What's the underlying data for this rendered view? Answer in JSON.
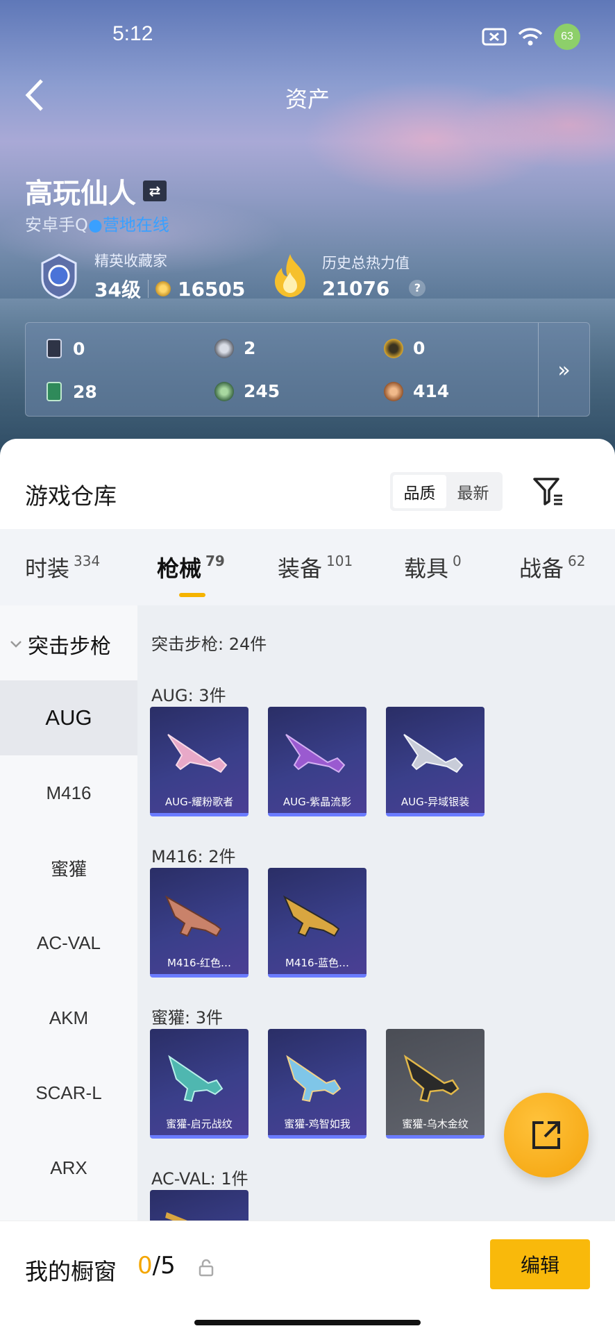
{
  "status_bar": {
    "time": "5:12",
    "battery": "63"
  },
  "header": {
    "title": "资产"
  },
  "profile": {
    "name": "高玩仙人",
    "platform": "安卓手Q",
    "online_status": "营地在线",
    "rank_title": "精英收藏家",
    "level": "34级",
    "points": "16505",
    "heat_label": "历史总热力值",
    "heat_value": "21076",
    "help": "?"
  },
  "stats": [
    {
      "value": "0",
      "icon": "card-icon"
    },
    {
      "value": "2",
      "icon": "silver-coin-icon"
    },
    {
      "value": "0",
      "icon": "gold-coin-icon"
    },
    {
      "value": "28",
      "icon": "green-card-icon"
    },
    {
      "value": "245",
      "icon": "green-coin-icon"
    },
    {
      "value": "414",
      "icon": "bronze-coin-icon"
    }
  ],
  "stats_more": "»",
  "warehouse": {
    "title": "游戏仓库",
    "sort_options": [
      "品质",
      "最新"
    ],
    "tabs": [
      {
        "label": "时装",
        "count": "334"
      },
      {
        "label": "枪械",
        "count": "79"
      },
      {
        "label": "装备",
        "count": "101"
      },
      {
        "label": "载具",
        "count": "0"
      },
      {
        "label": "战备",
        "count": "62"
      }
    ]
  },
  "sidebar": {
    "group": "突击步枪",
    "items": [
      "AUG",
      "M416",
      "蜜獾",
      "AC-VAL",
      "AKM",
      "SCAR-L",
      "ARX"
    ]
  },
  "content": {
    "summary": "突击步枪: 24件",
    "sections": [
      {
        "header": "AUG: 3件",
        "cards": [
          "AUG-耀粉歌者",
          "AUG-紫晶流影",
          "AUG-异域银装"
        ]
      },
      {
        "header": "M416: 2件",
        "cards": [
          "M416-红色…",
          "M416-蓝色…"
        ]
      },
      {
        "header": "蜜獾: 3件",
        "cards": [
          "蜜獾-启元战纹",
          "蜜獾-鸡智如我",
          "蜜獾-乌木金纹"
        ]
      },
      {
        "header": "AC-VAL: 1件",
        "cards": []
      }
    ]
  },
  "bottom_bar": {
    "label": "我的橱窗",
    "count_current": "0",
    "count_total": "/5",
    "edit_button": "编辑"
  },
  "colors": {
    "accent": "#f9b90b",
    "online": "#3aa0ff",
    "card_bg": "#3a3f8a"
  }
}
